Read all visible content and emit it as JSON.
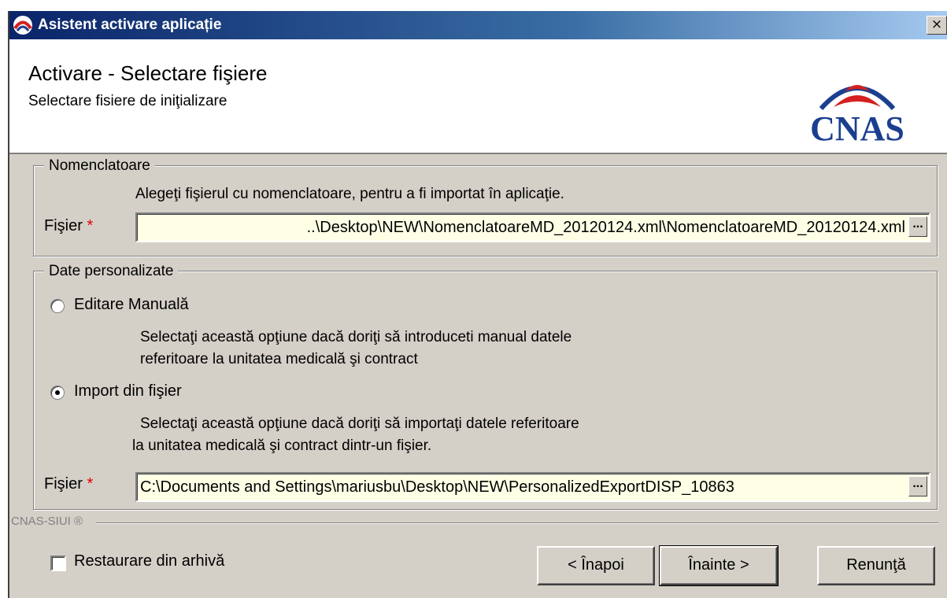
{
  "window": {
    "title": "Asistent activare aplicație",
    "close_glyph": "×"
  },
  "header": {
    "title": "Activare - Selectare fişiere",
    "subtitle": "Selectare fisiere de iniţializare",
    "logo_text": "CNAS"
  },
  "nomenclatoare": {
    "legend": "Nomenclatoare",
    "description": "Alegeţi fişierul cu nomenclatoare, pentru a fi importat în aplicaţie.",
    "file_label": "Fişier",
    "required_mark": "*",
    "file_value": "..\\Desktop\\NEW\\NomenclatoareMD_20120124.xml\\NomenclatoareMD_20120124.xml",
    "browse_glyph": "..."
  },
  "date_personalizate": {
    "legend": "Date personalizate",
    "option_manual": {
      "label": "Editare Manuală",
      "selected": false,
      "description_line1": "Selectaţi această opţiune dacă doriţi să introduceti manual datele",
      "description_line2": "referitoare la unitatea medicală şi contract"
    },
    "option_import": {
      "label": "Import din fişier",
      "selected": true,
      "description_line1": "Selectaţi această opţiune dacă doriţi să importaţi datele referitoare",
      "description_line2": "la unitatea medicală şi contract dintr-un fişier."
    },
    "file_label": "Fişier",
    "required_mark": "*",
    "file_value": "C:\\Documents and Settings\\mariusbu\\Desktop\\NEW\\PersonalizedExportDISP_10863",
    "browse_glyph": "..."
  },
  "footer": {
    "brand": "CNAS-SIUI ®",
    "restore_label": "Restaurare din arhivă",
    "restore_checked": false,
    "back_button": "< Înapoi",
    "next_button": "Înainte >",
    "cancel_button": "Renunţă"
  },
  "colors": {
    "dialog_bg": "#d4d0c8",
    "titlebar_start": "#0a246a",
    "titlebar_end": "#a6caf0",
    "logo_blue": "#1b3f8f",
    "logo_red": "#d42020",
    "input_bg": "#ffffe6",
    "required_red": "#e00000"
  },
  "icons": {
    "window_icon": "cnas-logo-icon",
    "close": "close-icon",
    "browse": "ellipsis-icon"
  }
}
